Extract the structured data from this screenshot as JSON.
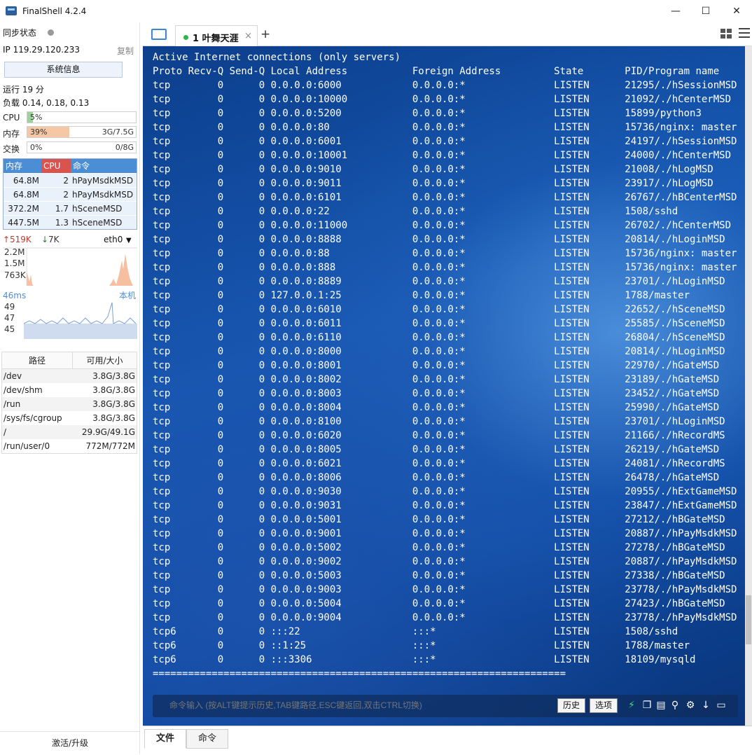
{
  "window": {
    "title": "FinalShell 4.2.4",
    "minimize": "—",
    "maximize": "☐",
    "close": "✕"
  },
  "sidebar": {
    "sync_label": "同步状态",
    "ip_label": "IP  119.29.120.233",
    "copy_label": "复制",
    "sysinfo_button": "系统信息",
    "uptime": "运行 19 分",
    "load": "负载 0.14, 0.18, 0.13",
    "cpu": {
      "label": "CPU",
      "percent": "5%",
      "value": 0.05
    },
    "mem": {
      "label": "内存",
      "percent": "39%",
      "size": "3G/7.5G",
      "value": 0.39
    },
    "swap": {
      "label": "交换",
      "percent": "0%",
      "size": "0/8G",
      "value": 0.0
    },
    "proc_headers": [
      "内存",
      "CPU",
      "命令"
    ],
    "processes": [
      {
        "mem": "64.8M",
        "cpu": "2",
        "cmd": "hPayMsdkMSD"
      },
      {
        "mem": "64.8M",
        "cpu": "2",
        "cmd": "hPayMsdkMSD"
      },
      {
        "mem": "372.2M",
        "cpu": "1.7",
        "cmd": "hSceneMSD"
      },
      {
        "mem": "447.5M",
        "cpu": "1.3",
        "cmd": "hSceneMSD"
      }
    ],
    "net": {
      "up": "519K",
      "down": "7K",
      "iface": "eth0",
      "ticks": [
        "2.2M",
        "1.5M",
        "763K"
      ]
    },
    "ping": {
      "latency": "46ms",
      "host": "本机",
      "ticks": [
        "49",
        "47",
        "45"
      ]
    },
    "disk_headers": [
      "路径",
      "可用/大小"
    ],
    "disks": [
      {
        "path": "/dev",
        "size": "3.8G/3.8G"
      },
      {
        "path": "/dev/shm",
        "size": "3.8G/3.8G"
      },
      {
        "path": "/run",
        "size": "3.8G/3.8G"
      },
      {
        "path": "/sys/fs/cgroup",
        "size": "3.8G/3.8G"
      },
      {
        "path": "/",
        "size": "29.9G/49.1G"
      },
      {
        "path": "/run/user/0",
        "size": "772M/772M"
      }
    ],
    "activate": "激活/升级"
  },
  "tabs": {
    "session": "1 叶舞天涯",
    "close": "×",
    "add": "+"
  },
  "terminal": {
    "lines": [
      "Active Internet connections (only servers)",
      "Proto Recv-Q Send-Q Local Address           Foreign Address         State       PID/Program name",
      "tcp        0      0 0.0.0.0:6000            0.0.0.0:*               LISTEN      21295/./hSessionMSD",
      "tcp        0      0 0.0.0.0:10000           0.0.0.0:*               LISTEN      21092/./hCenterMSD",
      "tcp        0      0 0.0.0.0:5200            0.0.0.0:*               LISTEN      15899/python3",
      "tcp        0      0 0.0.0.0:80              0.0.0.0:*               LISTEN      15736/nginx: master",
      "tcp        0      0 0.0.0.0:6001            0.0.0.0:*               LISTEN      24197/./hSessionMSD",
      "tcp        0      0 0.0.0.0:10001           0.0.0.0:*               LISTEN      24000/./hCenterMSD",
      "tcp        0      0 0.0.0.0:9010            0.0.0.0:*               LISTEN      21008/./hLogMSD",
      "tcp        0      0 0.0.0.0:9011            0.0.0.0:*               LISTEN      23917/./hLogMSD",
      "tcp        0      0 0.0.0.0:6101            0.0.0.0:*               LISTEN      26767/./hBCenterMSD",
      "tcp        0      0 0.0.0.0:22              0.0.0.0:*               LISTEN      1508/sshd",
      "tcp        0      0 0.0.0.0:11000           0.0.0.0:*               LISTEN      26702/./hCenterMSD",
      "tcp        0      0 0.0.0.0:8888            0.0.0.0:*               LISTEN      20814/./hLoginMSD",
      "tcp        0      0 0.0.0.0:88              0.0.0.0:*               LISTEN      15736/nginx: master",
      "tcp        0      0 0.0.0.0:888             0.0.0.0:*               LISTEN      15736/nginx: master",
      "tcp        0      0 0.0.0.0:8889            0.0.0.0:*               LISTEN      23701/./hLoginMSD",
      "tcp        0      0 127.0.0.1:25            0.0.0.0:*               LISTEN      1788/master",
      "tcp        0      0 0.0.0.0:6010            0.0.0.0:*               LISTEN      22652/./hSceneMSD",
      "tcp        0      0 0.0.0.0:6011            0.0.0.0:*               LISTEN      25585/./hSceneMSD",
      "tcp        0      0 0.0.0.0:6110            0.0.0.0:*               LISTEN      26804/./hSceneMSD",
      "tcp        0      0 0.0.0.0:8000            0.0.0.0:*               LISTEN      20814/./hLoginMSD",
      "tcp        0      0 0.0.0.0:8001            0.0.0.0:*               LISTEN      22970/./hGateMSD",
      "tcp        0      0 0.0.0.0:8002            0.0.0.0:*               LISTEN      23189/./hGateMSD",
      "tcp        0      0 0.0.0.0:8003            0.0.0.0:*               LISTEN      23452/./hGateMSD",
      "tcp        0      0 0.0.0.0:8004            0.0.0.0:*               LISTEN      25990/./hGateMSD",
      "tcp        0      0 0.0.0.0:8100            0.0.0.0:*               LISTEN      23701/./hLoginMSD",
      "tcp        0      0 0.0.0.0:6020            0.0.0.0:*               LISTEN      21166/./hRecordMS",
      "tcp        0      0 0.0.0.0:8005            0.0.0.0:*               LISTEN      26219/./hGateMSD",
      "tcp        0      0 0.0.0.0:6021            0.0.0.0:*               LISTEN      24081/./hRecordMS",
      "tcp        0      0 0.0.0.0:8006            0.0.0.0:*               LISTEN      26478/./hGateMSD",
      "tcp        0      0 0.0.0.0:9030            0.0.0.0:*               LISTEN      20955/./hExtGameMSD",
      "tcp        0      0 0.0.0.0:9031            0.0.0.0:*               LISTEN      23847/./hExtGameMSD",
      "tcp        0      0 0.0.0.0:5001            0.0.0.0:*               LISTEN      27212/./hBGateMSD",
      "tcp        0      0 0.0.0.0:9001            0.0.0.0:*               LISTEN      20887/./hPayMsdkMSD",
      "tcp        0      0 0.0.0.0:5002            0.0.0.0:*               LISTEN      27278/./hBGateMSD",
      "tcp        0      0 0.0.0.0:9002            0.0.0.0:*               LISTEN      20887/./hPayMsdkMSD",
      "tcp        0      0 0.0.0.0:5003            0.0.0.0:*               LISTEN      27338/./hBGateMSD",
      "tcp        0      0 0.0.0.0:9003            0.0.0.0:*               LISTEN      23778/./hPayMsdkMSD",
      "tcp        0      0 0.0.0.0:5004            0.0.0.0:*               LISTEN      27423/./hBGateMSD",
      "tcp        0      0 0.0.0.0:9004            0.0.0.0:*               LISTEN      23778/./hPayMsdkMSD",
      "tcp6       0      0 :::22                   :::*                    LISTEN      1508/sshd",
      "tcp6       0      0 ::1:25                  :::*                    LISTEN      1788/master",
      "tcp6       0      0 :::3306                 :::*                    LISTEN      18109/mysqld",
      "======================================================================"
    ],
    "cmd_placeholder": "命令输入 (按ALT键提示历史,TAB键路径,ESC键返回,双击CTRL切换)",
    "history_button": "历史",
    "options_button": "选项"
  },
  "bottom_tabs": {
    "files": "文件",
    "commands": "命令"
  },
  "colors": {
    "accent": "#4c8ed6",
    "cpu_header": "#d9534f",
    "mem_fill": "#f5c7a5",
    "cpu_fill": "#9bd39b",
    "terminal_bg": "#1355b0"
  }
}
